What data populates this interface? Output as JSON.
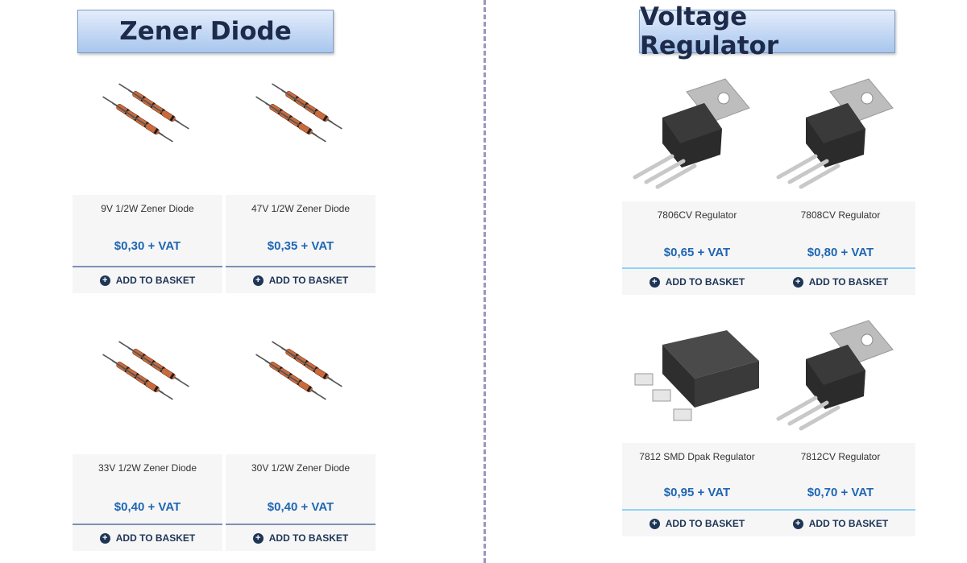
{
  "sections": {
    "zener_title": "Zener Diode",
    "regulator_title": "Voltage Regulator"
  },
  "zener_products": [
    {
      "name": "9V 1/2W Zener Diode",
      "price": "$0,30 + VAT",
      "button": "ADD TO BASKET"
    },
    {
      "name": "47V 1/2W Zener Diode",
      "price": "$0,35 + VAT",
      "button": "ADD TO BASKET"
    },
    {
      "name": "33V 1/2W Zener Diode",
      "price": "$0,40 + VAT",
      "button": "ADD TO BASKET"
    },
    {
      "name": "30V 1/2W Zener Diode",
      "price": "$0,40 + VAT",
      "button": "ADD TO BASKET"
    }
  ],
  "regulator_products": [
    {
      "name": "7806CV Regulator",
      "price": "$0,65 + VAT",
      "button": "ADD TO BASKET"
    },
    {
      "name": "7808CV Regulator",
      "price": "$0,80 + VAT",
      "button": "ADD TO BASKET"
    },
    {
      "name": "7812 SMD Dpak Regulator",
      "price": "$0,95 + VAT",
      "button": "ADD TO BASKET"
    },
    {
      "name": "7812CV Regulator",
      "price": "$0,70 + VAT",
      "button": "ADD TO BASKET"
    }
  ],
  "icons": {
    "add": "plus-circle-icon",
    "zener_image": "zener-diodes-image",
    "to220_image": "to220-regulator-image",
    "dpak_image": "dpak-regulator-image"
  },
  "colors": {
    "price": "#1f66b3",
    "button_text": "#1f3556",
    "zener_separator": "#7f8fb4",
    "regulator_separator": "#8fd3f4",
    "title_gradient_top": "#e4edfb",
    "title_gradient_bottom": "#a8c6ee",
    "divider": "#9a97bf"
  }
}
